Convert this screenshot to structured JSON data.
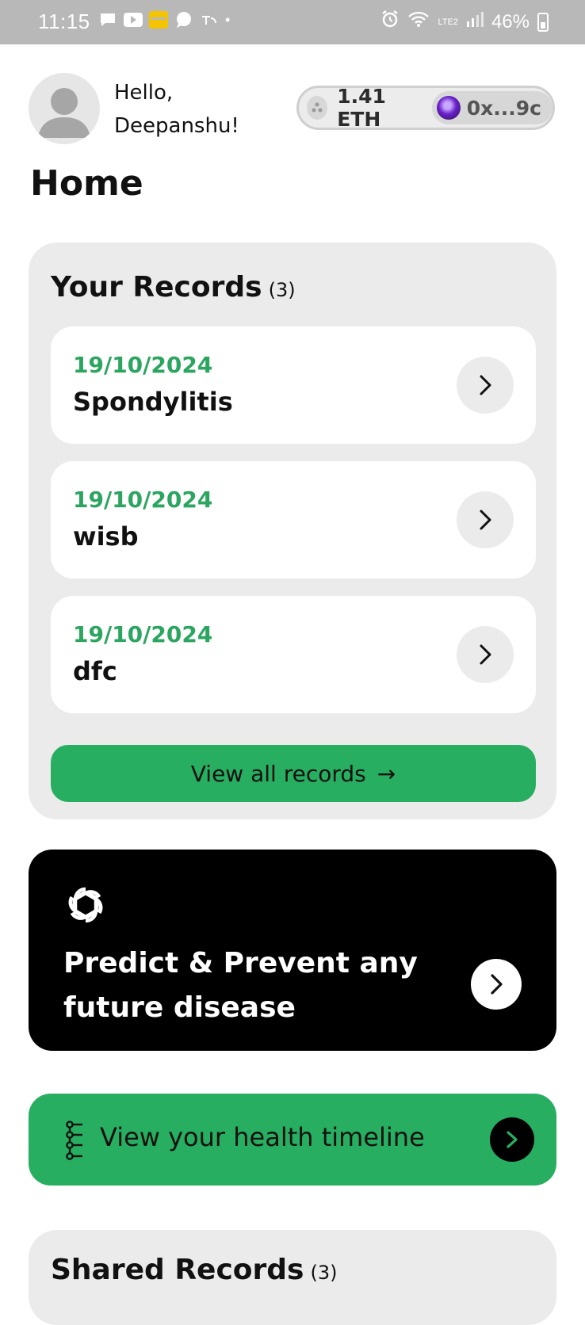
{
  "status_bar": {
    "time": "11:15",
    "battery": "46%",
    "network": "LTE2"
  },
  "header": {
    "greeting_line1": "Hello,",
    "greeting_line2": "Deepanshu!",
    "wallet": {
      "balance": "1.41 ETH",
      "address": "0x...9c"
    }
  },
  "page_title": "Home",
  "records": {
    "title": "Your Records",
    "count": "(3)",
    "items": [
      {
        "date": "19/10/2024",
        "name": "Spondylitis"
      },
      {
        "date": "19/10/2024",
        "name": "wisb"
      },
      {
        "date": "19/10/2024",
        "name": "dfc"
      }
    ],
    "view_all_label": "View all records",
    "view_all_arrow": "→"
  },
  "predict": {
    "label": "Predict & Prevent any future disease"
  },
  "timeline": {
    "label": "View your health timeline"
  },
  "shared_records": {
    "title": "Shared Records",
    "count": "(3)"
  },
  "colors": {
    "accent_green": "#27ae60",
    "date_green": "#2ba55f",
    "card_gray": "#ebebeb"
  },
  "icons": {
    "record_chevron": "chevron-right-icon",
    "predict_logo": "openai-icon",
    "timeline_icon": "timeline-icon"
  }
}
